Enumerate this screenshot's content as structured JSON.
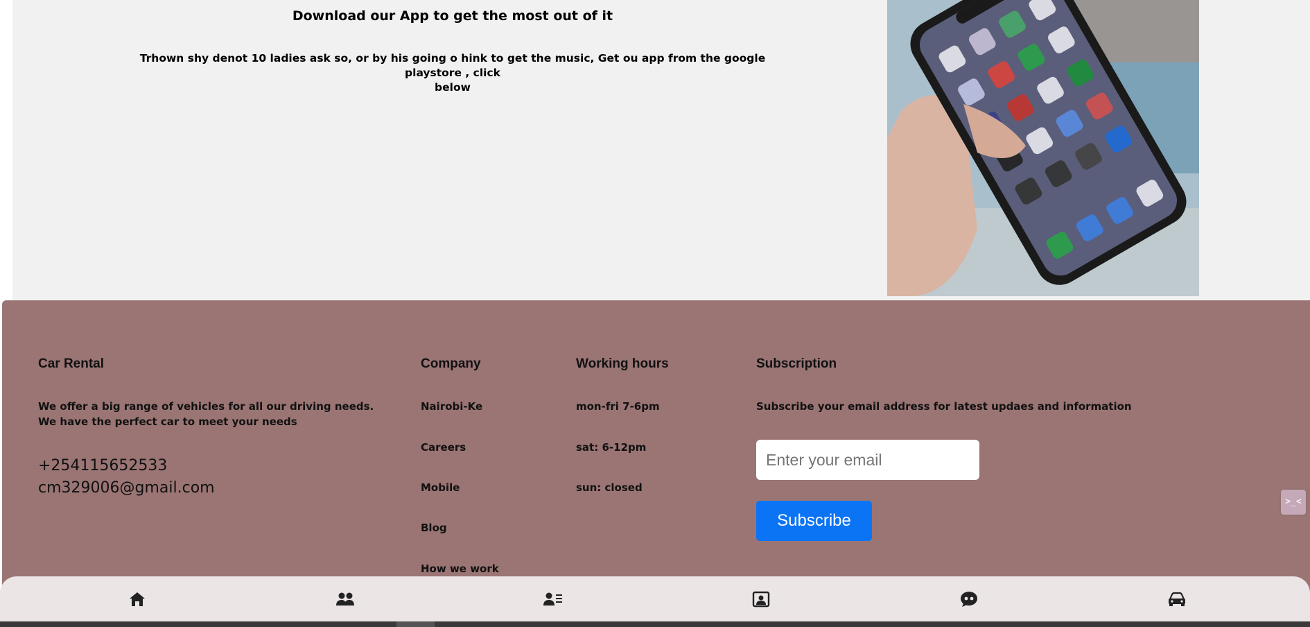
{
  "app_section": {
    "title": "Download our App to get the most out of it",
    "description_line1": "Trhown shy denot 10 ladies ask so, or by his going o hink to get the music, Get ou app from the google playstore , click",
    "description_line2": "below"
  },
  "footer": {
    "about": {
      "title": "Car Rental",
      "line1": "We offer a big range of vehicles for all our driving needs.",
      "line2": "We have the perfect car to meet your needs",
      "phone": "+254115652533",
      "email": "cm329006@gmail.com"
    },
    "company": {
      "title": "Company",
      "links": [
        "Nairobi-Ke",
        "Careers",
        "Mobile",
        "Blog",
        "How we work"
      ]
    },
    "working_hours": {
      "title": "Working hours",
      "items": [
        "mon-fri 7-6pm",
        "sat: 6-12pm",
        "sun: closed"
      ]
    },
    "subscription": {
      "title": "Subscription",
      "text": "Subscribe your email address for latest updaes and information",
      "placeholder": "Enter your email",
      "button": "Subscribe"
    },
    "side_toggle": ">_<"
  },
  "bottom_nav": {
    "items": [
      {
        "icon": "home-icon"
      },
      {
        "icon": "users-icon"
      },
      {
        "icon": "user-list-icon"
      },
      {
        "icon": "contact-card-icon"
      },
      {
        "icon": "chat-quote-icon"
      },
      {
        "icon": "car-icon"
      }
    ]
  },
  "colors": {
    "footer_bg": "#9a7574",
    "section_bg": "#f1f1f1",
    "subscribe_button": "#0b74f5",
    "nav_bg": "#ece5e6"
  }
}
